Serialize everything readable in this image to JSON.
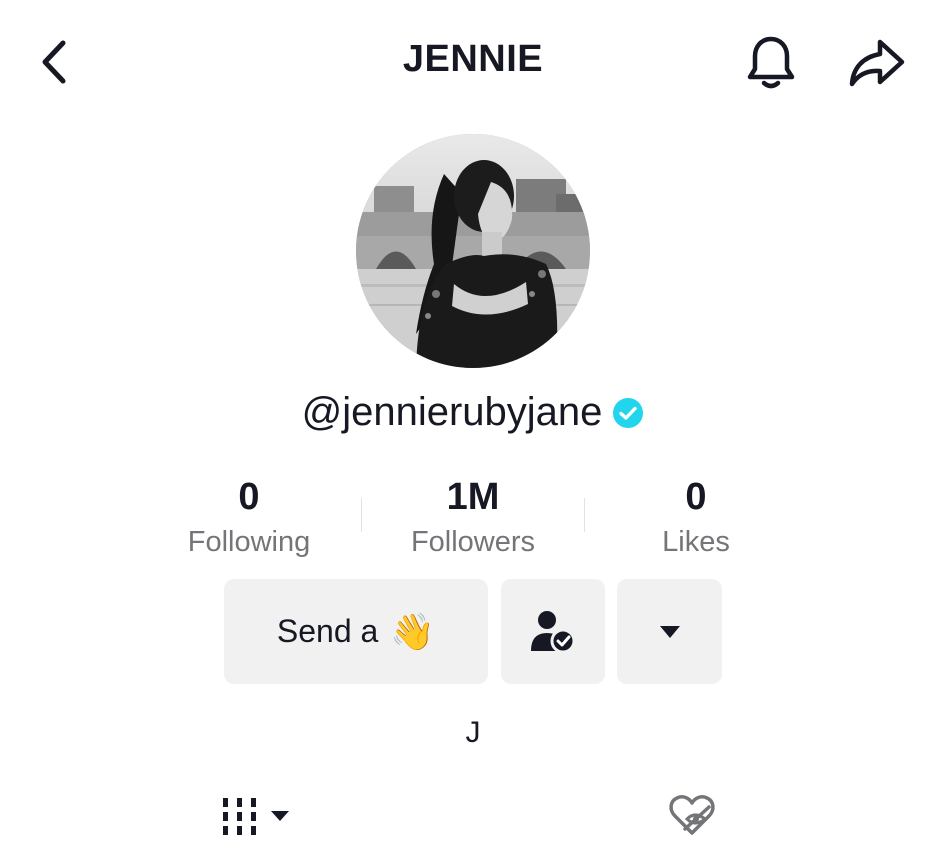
{
  "header": {
    "title": "JENNIE"
  },
  "profile": {
    "username": "@jennierubyjane",
    "verified": true,
    "bio": "J"
  },
  "stats": [
    {
      "value": "0",
      "label": "Following"
    },
    {
      "value": "1M",
      "label": "Followers"
    },
    {
      "value": "0",
      "label": "Likes"
    }
  ],
  "actions": {
    "send_label": "Send a",
    "send_emoji": "👋"
  },
  "icons": {
    "back": "chevron-left-icon",
    "bell": "bell-icon",
    "share": "share-arrow-icon",
    "friend": "user-check-icon",
    "more": "caret-down-icon",
    "grid": "grid-icon",
    "liked": "hidden-heart-icon"
  },
  "colors": {
    "text": "#161823",
    "secondary_text": "#747579",
    "button_bg": "#f1f1f2",
    "verified_badge": "#20d5ec"
  }
}
